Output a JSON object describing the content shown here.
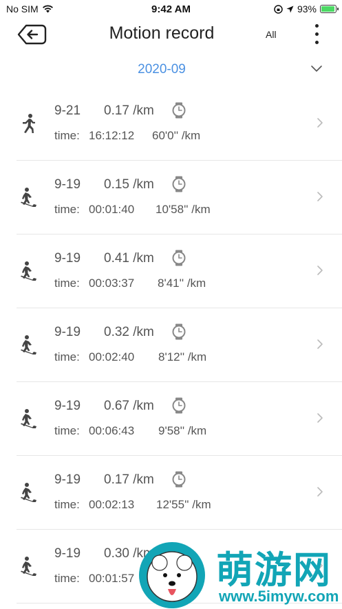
{
  "status_bar": {
    "carrier": "No SIM",
    "time": "9:42 AM",
    "battery": "93%",
    "battery_level": 0.93
  },
  "header": {
    "title": "Motion record",
    "filter_label": "All",
    "back_icon": "back-arrow-icon",
    "more_icon": "more-vertical-icon"
  },
  "month": {
    "label": "2020-09",
    "color": "#4a90e2"
  },
  "records": [
    {
      "date": "9-21",
      "distance": "0.17 /km",
      "time_label": "time:",
      "time": "16:12:12",
      "pace": "60'0'' /km",
      "type": "walk"
    },
    {
      "date": "9-19",
      "distance": "0.15 /km",
      "time_label": "time:",
      "time": "00:01:40",
      "pace": "10'58'' /km",
      "type": "treadmill"
    },
    {
      "date": "9-19",
      "distance": "0.41 /km",
      "time_label": "time:",
      "time": "00:03:37",
      "pace": "8'41'' /km",
      "type": "treadmill"
    },
    {
      "date": "9-19",
      "distance": "0.32 /km",
      "time_label": "time:",
      "time": "00:02:40",
      "pace": "8'12'' /km",
      "type": "treadmill"
    },
    {
      "date": "9-19",
      "distance": "0.67 /km",
      "time_label": "time:",
      "time": "00:06:43",
      "pace": "9'58'' /km",
      "type": "treadmill"
    },
    {
      "date": "9-19",
      "distance": "0.17 /km",
      "time_label": "time:",
      "time": "00:02:13",
      "pace": "12'55'' /km",
      "type": "treadmill"
    },
    {
      "date": "9-19",
      "distance": "0.30 /km",
      "time_label": "time:",
      "time": "00:01:57",
      "pace": "",
      "type": "treadmill"
    }
  ],
  "watermark": {
    "text": "萌游网",
    "url": "www.5imyw.com",
    "color": "#12a5b6"
  }
}
